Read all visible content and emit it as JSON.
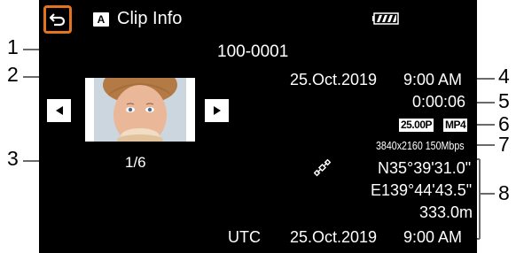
{
  "header": {
    "back_icon": "back-arrow-icon",
    "mode_badge": "A",
    "title": "Clip Info",
    "battery_icon": "battery-icon"
  },
  "clip": {
    "number": "100-0001",
    "date": "25.Oct.2019",
    "time": "9:00 AM",
    "duration": "0:00:06",
    "frame_rate": "25.00P",
    "format": "MP4",
    "resolution_bitrate": "3840x2160 150Mbps"
  },
  "thumbnail": {
    "counter": "1/6",
    "prev_icon": "triangle-left-icon",
    "next_icon": "triangle-right-icon"
  },
  "gps": {
    "icon": "satellite-icon",
    "latitude": "N35°39'31.0\"",
    "longitude": "E139°44'43.5\"",
    "altitude": "333.0m",
    "utc_label": "UTC",
    "utc_date": "25.Oct.2019",
    "utc_time": "9:00 AM"
  },
  "callouts": [
    "1",
    "2",
    "3",
    "4",
    "5",
    "6",
    "7",
    "8"
  ],
  "colors": {
    "screen_bg": "#000000",
    "accent": "#e3741d",
    "text": "#ffffff"
  }
}
